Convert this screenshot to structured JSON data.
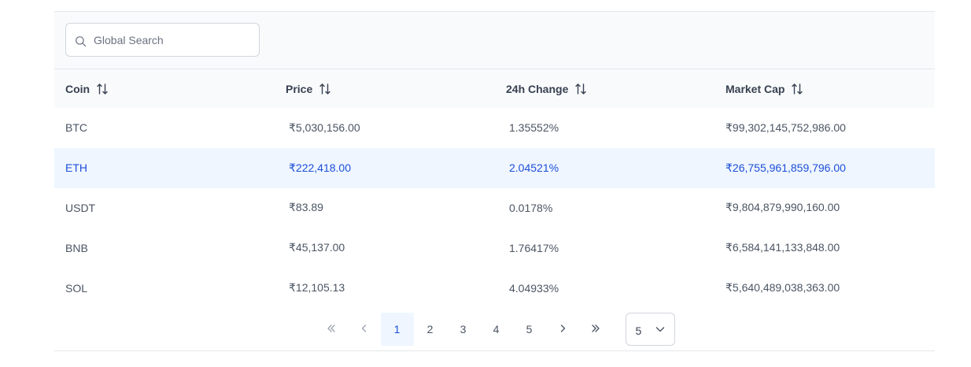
{
  "search": {
    "placeholder": "Global Search",
    "icon": "search-icon"
  },
  "table": {
    "columns": [
      {
        "label": "Coin",
        "icon": "sort-icon"
      },
      {
        "label": "Price",
        "icon": "sort-icon"
      },
      {
        "label": "24h Change",
        "icon": "sort-icon"
      },
      {
        "label": "Market Cap",
        "icon": "sort-icon"
      }
    ],
    "rows": [
      {
        "coin": "BTC",
        "price": "₹5,030,156.00",
        "change": "1.35552%",
        "cap": "₹99,302,145,752,986.00",
        "selected": false
      },
      {
        "coin": "ETH",
        "price": "₹222,418.00",
        "change": "2.04521%",
        "cap": "₹26,755,961,859,796.00",
        "selected": true
      },
      {
        "coin": "USDT",
        "price": "₹83.89",
        "change": "0.0178%",
        "cap": "₹9,804,879,990,160.00",
        "selected": false
      },
      {
        "coin": "BNB",
        "price": "₹45,137.00",
        "change": "1.76417%",
        "cap": "₹6,584,141,133,848.00",
        "selected": false
      },
      {
        "coin": "SOL",
        "price": "₹12,105.13",
        "change": "4.04933%",
        "cap": "₹5,640,489,038,363.00",
        "selected": false
      }
    ]
  },
  "paginator": {
    "pages": [
      "1",
      "2",
      "3",
      "4",
      "5"
    ],
    "current_page": "1",
    "rows_per_page": "5",
    "icons": {
      "first": "double-chevron-left-icon",
      "prev": "chevron-left-icon",
      "next": "chevron-right-icon",
      "last": "double-chevron-right-icon",
      "dropdown": "chevron-down-icon"
    }
  },
  "colors": {
    "selected_row_bg": "#eff6ff",
    "selected_text": "#1d4ed8",
    "header_bg": "#f9fafb"
  }
}
